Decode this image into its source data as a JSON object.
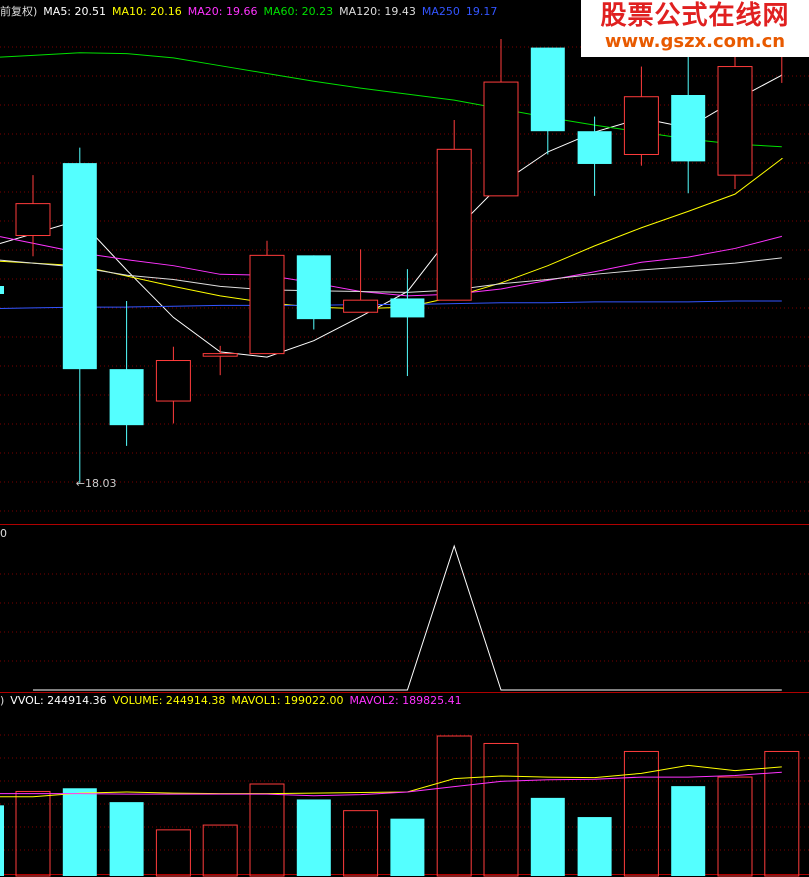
{
  "price_legend": [
    {
      "text": "前复权)",
      "color": "#dddddd"
    },
    {
      "text": "MA5: 20.51",
      "color": "#ffffff"
    },
    {
      "text": "MA10: 20.16",
      "color": "#ffff00"
    },
    {
      "text": "MA20: 19.66",
      "color": "#ff33ff"
    },
    {
      "text": "MA60: 20.23",
      "color": "#00e000"
    },
    {
      "text": "MA120: 19.43",
      "color": "#dddddd"
    },
    {
      "text": "MA250",
      "color": "#3355ff"
    },
    {
      "text": "19.17",
      "color": "#3355ff"
    }
  ],
  "volume_legend": [
    {
      "text": ")",
      "color": "#dddddd"
    },
    {
      "text": "VVOL: 244914.36",
      "color": "#ffffff"
    },
    {
      "text": "VOLUME: 244914.38",
      "color": "#ffff00"
    },
    {
      "text": "MAVOL1: 199022.00",
      "color": "#ffff00"
    },
    {
      "text": "MAVOL2: 189825.41",
      "color": "#ff33ff"
    }
  ],
  "indicator_zero": "0",
  "watermark": {
    "title": "股票公式在线网",
    "url": "www.gszx.com.cn"
  },
  "colors": {
    "up": "#ff3c3c",
    "down": "#54ffff",
    "grid": "#7a0000"
  },
  "chart_data": {
    "type": "candlestick",
    "price_axis": {
      "ylim": [
        17.6,
        23.4
      ]
    },
    "low_label": "←18.03",
    "candles": [
      {
        "open": 20.9,
        "close": 21.27,
        "high": 21.6,
        "low": 20.66,
        "dir": "up"
      },
      {
        "open": 21.74,
        "close": 19.35,
        "high": 21.92,
        "low": 18.03,
        "dir": "down"
      },
      {
        "open": 19.35,
        "close": 18.7,
        "high": 20.14,
        "low": 18.46,
        "dir": "down"
      },
      {
        "open": 18.98,
        "close": 19.45,
        "high": 19.61,
        "low": 18.72,
        "dir": "up"
      },
      {
        "open": 19.5,
        "close": 19.53,
        "high": 19.62,
        "low": 19.28,
        "dir": "up"
      },
      {
        "open": 19.53,
        "close": 20.67,
        "high": 20.84,
        "low": 19.53,
        "dir": "up"
      },
      {
        "open": 20.67,
        "close": 19.93,
        "high": 20.67,
        "low": 19.81,
        "dir": "down"
      },
      {
        "open": 20.01,
        "close": 20.15,
        "high": 20.74,
        "low": 20.01,
        "dir": "up"
      },
      {
        "open": 20.17,
        "close": 19.95,
        "high": 20.51,
        "low": 19.27,
        "dir": "down"
      },
      {
        "open": 20.15,
        "close": 21.9,
        "high": 22.24,
        "low": 20.15,
        "dir": "up"
      },
      {
        "open": 21.36,
        "close": 22.68,
        "high": 23.18,
        "low": 21.36,
        "dir": "up"
      },
      {
        "open": 23.08,
        "close": 22.11,
        "high": 23.08,
        "low": 21.84,
        "dir": "down"
      },
      {
        "open": 22.11,
        "close": 21.73,
        "high": 22.28,
        "low": 21.36,
        "dir": "down"
      },
      {
        "open": 21.84,
        "close": 22.51,
        "high": 22.86,
        "low": 21.71,
        "dir": "up"
      },
      {
        "open": 22.53,
        "close": 21.76,
        "high": 23.33,
        "low": 21.39,
        "dir": "down"
      },
      {
        "open": 21.6,
        "close": 22.86,
        "high": 22.99,
        "low": 21.44,
        "dir": "up"
      },
      {
        "open": 22.99,
        "close": 23.58,
        "high": 23.8,
        "low": 22.67,
        "dir": "up"
      }
    ],
    "ma_lines": [
      {
        "name": "MA5",
        "color": "#ffffff",
        "values": [
          20.92,
          21.08,
          20.5,
          19.95,
          19.55,
          19.49,
          19.68,
          19.96,
          20.25,
          20.95,
          21.5,
          21.87,
          22.1,
          22.26,
          22.15,
          22.47,
          22.76
        ]
      },
      {
        "name": "MA10",
        "color": "#ffff00",
        "values": [
          20.58,
          20.55,
          20.43,
          20.31,
          20.2,
          20.12,
          20.07,
          20.05,
          20.07,
          20.19,
          20.35,
          20.55,
          20.78,
          20.99,
          21.18,
          21.38,
          21.79
        ]
      },
      {
        "name": "MA20",
        "color": "#ff33ff",
        "values": [
          20.81,
          20.7,
          20.62,
          20.55,
          20.45,
          20.44,
          20.35,
          20.25,
          20.2,
          20.22,
          20.28,
          20.38,
          20.48,
          20.59,
          20.65,
          20.75,
          20.89
        ]
      },
      {
        "name": "MA60",
        "color": "#00e000",
        "values": [
          22.99,
          23.02,
          23.01,
          22.96,
          22.87,
          22.78,
          22.69,
          22.61,
          22.54,
          22.47,
          22.37,
          22.27,
          22.18,
          22.1,
          22.02,
          21.96,
          21.93
        ]
      },
      {
        "name": "MA120",
        "color": "#dddddd",
        "values": [
          20.58,
          20.53,
          20.44,
          20.39,
          20.31,
          20.27,
          20.26,
          20.25,
          20.24,
          20.27,
          20.34,
          20.39,
          20.45,
          20.5,
          20.54,
          20.58,
          20.64
        ]
      },
      {
        "name": "MA250",
        "color": "#3355ff",
        "values": [
          20.06,
          20.07,
          20.07,
          20.08,
          20.09,
          20.09,
          20.09,
          20.1,
          20.1,
          20.11,
          20.12,
          20.12,
          20.13,
          20.13,
          20.13,
          20.14,
          20.14
        ]
      }
    ],
    "indicator": {
      "ylim": [
        0,
        1
      ],
      "values": [
        0,
        0,
        0,
        0,
        0,
        0,
        0,
        0,
        0,
        1,
        0,
        0,
        0,
        0,
        0,
        0,
        0
      ]
    },
    "volume": {
      "ylim": [
        0,
        300000
      ],
      "values": [
        151000,
        157000,
        131000,
        79000,
        88000,
        165000,
        136000,
        115000,
        100000,
        255000,
        241000,
        139000,
        103000,
        226000,
        161000,
        178000,
        226000
      ],
      "mavol1": [
        141000,
        148000,
        150000,
        148000,
        147000,
        147000,
        148000,
        149000,
        150000,
        175000,
        180000,
        178000,
        177000,
        185000,
        200000,
        190000,
        197000
      ],
      "mavol2": [
        147000,
        147000,
        146000,
        146000,
        146000,
        146000,
        143000,
        145000,
        150000,
        160000,
        170000,
        173000,
        174000,
        178000,
        178000,
        181000,
        187000
      ]
    }
  }
}
